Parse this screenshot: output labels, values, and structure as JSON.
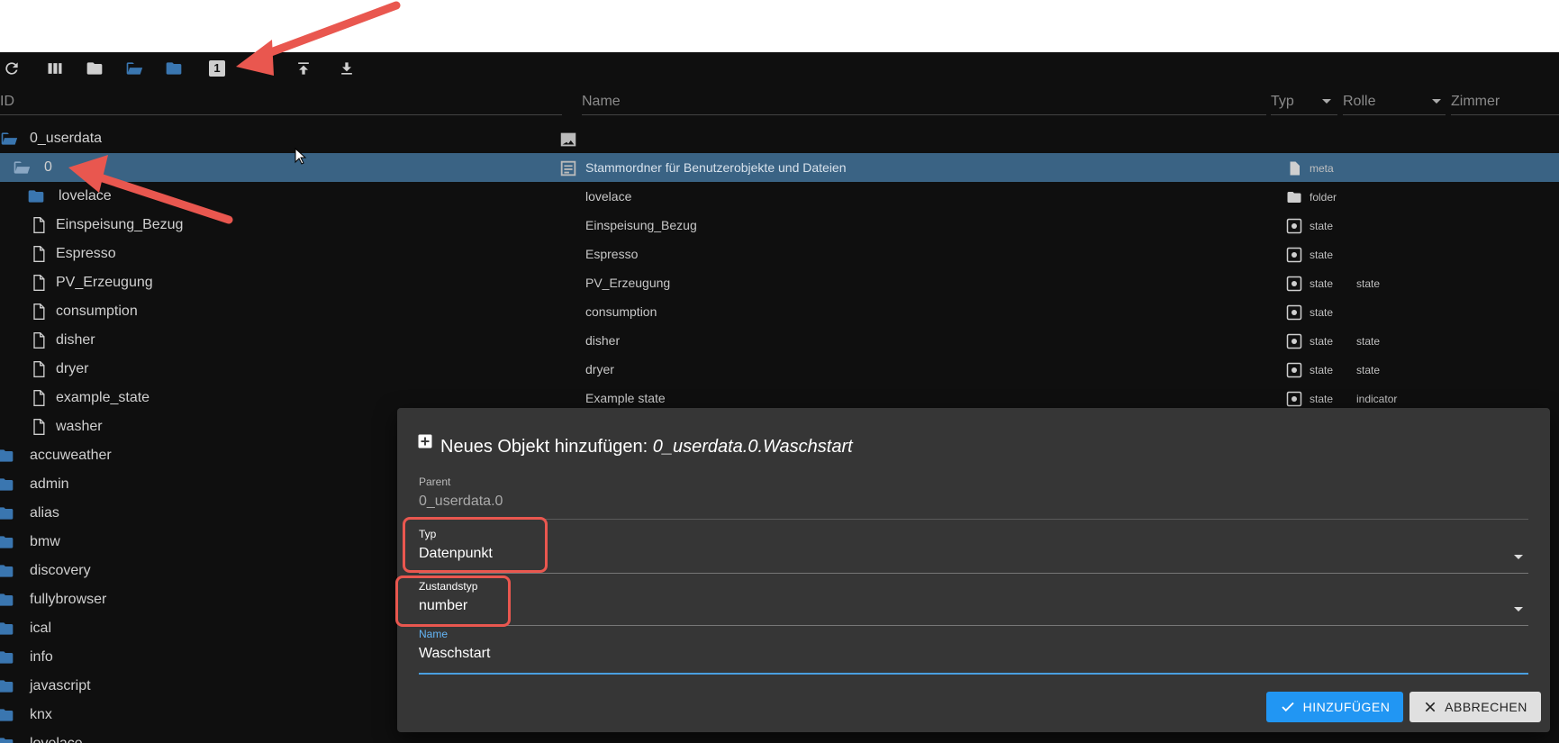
{
  "toolbar": {
    "icons": [
      "refresh-icon",
      "columns-icon",
      "folder-icon",
      "folder-open-icon",
      "folder-blue-icon",
      "badge-one-icon",
      "add-icon",
      "upload-icon",
      "download-icon"
    ],
    "badge": "1",
    "add": "+"
  },
  "header": {
    "id": "ID",
    "name": "Name",
    "type": "Typ",
    "role": "Rolle",
    "room": "Zimmer"
  },
  "tree": [
    {
      "label": "0_userdata",
      "name": "",
      "type": "",
      "role": ""
    },
    {
      "label": "0",
      "name": "Stammordner für Benutzerobjekte und Dateien",
      "type": "meta",
      "role": ""
    },
    {
      "label": "lovelace",
      "name": "lovelace",
      "type": "folder",
      "role": ""
    },
    {
      "label": "Einspeisung_Bezug",
      "name": "Einspeisung_Bezug",
      "type": "state",
      "role": ""
    },
    {
      "label": "Espresso",
      "name": "Espresso",
      "type": "state",
      "role": ""
    },
    {
      "label": "PV_Erzeugung",
      "name": "PV_Erzeugung",
      "type": "state",
      "role": "state"
    },
    {
      "label": "consumption",
      "name": "consumption",
      "type": "state",
      "role": ""
    },
    {
      "label": "disher",
      "name": "disher",
      "type": "state",
      "role": "state"
    },
    {
      "label": "dryer",
      "name": "dryer",
      "type": "state",
      "role": "state"
    },
    {
      "label": "example_state",
      "name": "Example state",
      "type": "state",
      "role": "indicator"
    },
    {
      "label": "washer",
      "name": "",
      "type": "",
      "role": ""
    },
    {
      "label": "accuweather"
    },
    {
      "label": "admin"
    },
    {
      "label": "alias"
    },
    {
      "label": "bmw"
    },
    {
      "label": "discovery"
    },
    {
      "label": "fullybrowser"
    },
    {
      "label": "ical"
    },
    {
      "label": "info"
    },
    {
      "label": "javascript"
    },
    {
      "label": "knx"
    },
    {
      "label": "lovelace"
    }
  ],
  "dialog": {
    "title_prefix": "Neues Objekt hinzufügen:",
    "title_path": "0_userdata.0.Waschstart",
    "parent_label": "Parent",
    "parent_value": "0_userdata.0",
    "type_label": "Typ",
    "type_value": "Datenpunkt",
    "statetype_label": "Zustandstyp",
    "statetype_value": "number",
    "name_label": "Name",
    "name_value": "Waschstart",
    "add_button": "HINZUFÜGEN",
    "cancel_button": "ABBRECHEN"
  },
  "colors": {
    "accent": "#2196f3",
    "selected_row": "#3a6384",
    "annotation": "#e9574f",
    "folder": "#3a76b0"
  }
}
